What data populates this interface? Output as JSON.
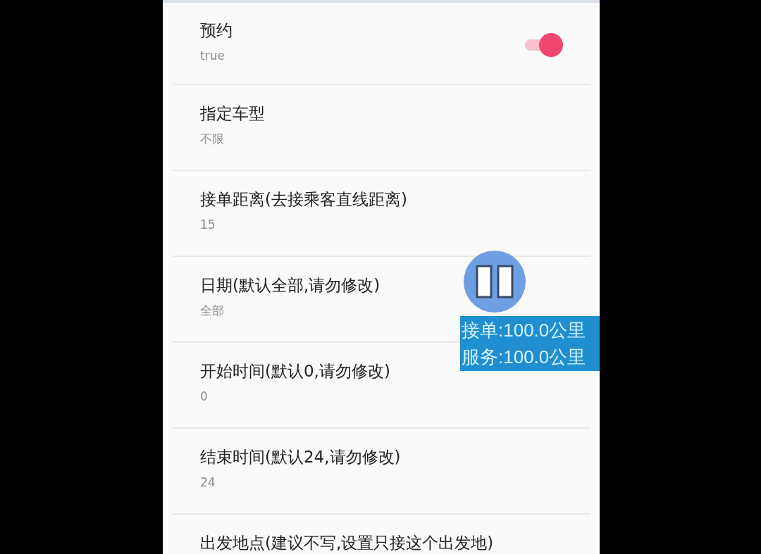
{
  "settings": [
    {
      "kind": "toggle",
      "title": "预约",
      "value": "true",
      "checked": true
    },
    {
      "kind": "text",
      "title": "指定车型",
      "value": "不限"
    },
    {
      "kind": "text",
      "title": "接单距离(去接乘客直线距离)",
      "value": "15"
    },
    {
      "kind": "text",
      "title": "日期(默认全部,请勿修改)",
      "value": "全部"
    },
    {
      "kind": "text",
      "title": "开始时间(默认0,请勿修改)",
      "value": "0"
    },
    {
      "kind": "text",
      "title": "结束时间(默认24,请勿修改)",
      "value": "24"
    },
    {
      "kind": "text",
      "title": "出发地点(建议不写,设置只接这个出发地)"
    }
  ],
  "overlay": {
    "lines": [
      "接单:100.0公里",
      "服务:100.0公里"
    ]
  }
}
